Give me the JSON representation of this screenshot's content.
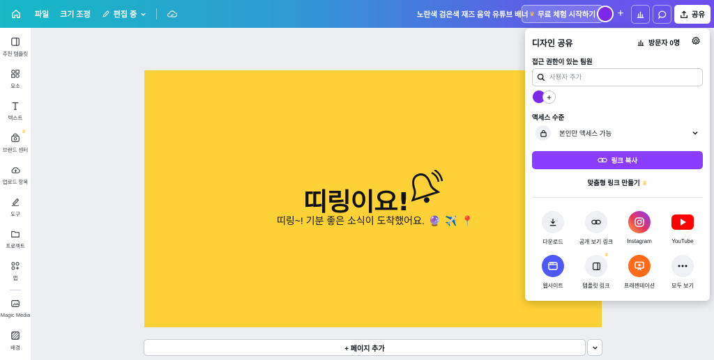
{
  "topbar": {
    "file": "파일",
    "resize": "크기 조정",
    "editing": "편집 중",
    "doc_title": "노란색 검은색 재즈 음악 유튜브 배너",
    "trial": "무료 체험 시작하기",
    "share": "공유"
  },
  "sidebar": {
    "items": [
      {
        "label": "추천 템플릿",
        "icon": "template-icon"
      },
      {
        "label": "요소",
        "icon": "elements-icon"
      },
      {
        "label": "텍스트",
        "icon": "text-icon"
      },
      {
        "label": "브랜드 센터",
        "icon": "brand-icon"
      },
      {
        "label": "업로드 항목",
        "icon": "upload-icon"
      },
      {
        "label": "도구",
        "icon": "draw-icon"
      },
      {
        "label": "프로젝트",
        "icon": "folder-icon"
      },
      {
        "label": "앱",
        "icon": "apps-icon"
      },
      {
        "label": "Magic Media",
        "icon": "magic-media-icon"
      },
      {
        "label": "배경",
        "icon": "background-icon"
      }
    ]
  },
  "canvas": {
    "headline": "띠링이요!",
    "subline": "띠링~! 기분 좋은 소식이 도착했어요.",
    "background": "#fed236"
  },
  "add_page": "+ 페이지 추가",
  "share_panel": {
    "title": "디자인 공유",
    "visitors": "방문자 0명",
    "team_label": "접근 권한이 있는 팀원",
    "search_placeholder": "사용자 추가",
    "access_label": "액세스 수준",
    "access_value": "본인만 액세스 가능",
    "copy_link": "링크 복사",
    "custom_link": "맞춤형 링크 만들기",
    "options": [
      {
        "label": "다운로드",
        "icon": "download-icon"
      },
      {
        "label": "공개 보기 링크",
        "icon": "link-icon"
      },
      {
        "label": "Instagram",
        "icon": "instagram-icon"
      },
      {
        "label": "YouTube",
        "icon": "youtube-icon"
      },
      {
        "label": "웹사이트",
        "icon": "website-icon"
      },
      {
        "label": "템플릿 링크",
        "icon": "template-link-icon"
      },
      {
        "label": "프레젠테이션",
        "icon": "presentation-icon"
      },
      {
        "label": "모두 보기",
        "icon": "more-icon"
      }
    ]
  },
  "colors": {
    "accent": "#8b3dff",
    "canvas": "#fed236",
    "avatar": "#7d2ae8"
  }
}
